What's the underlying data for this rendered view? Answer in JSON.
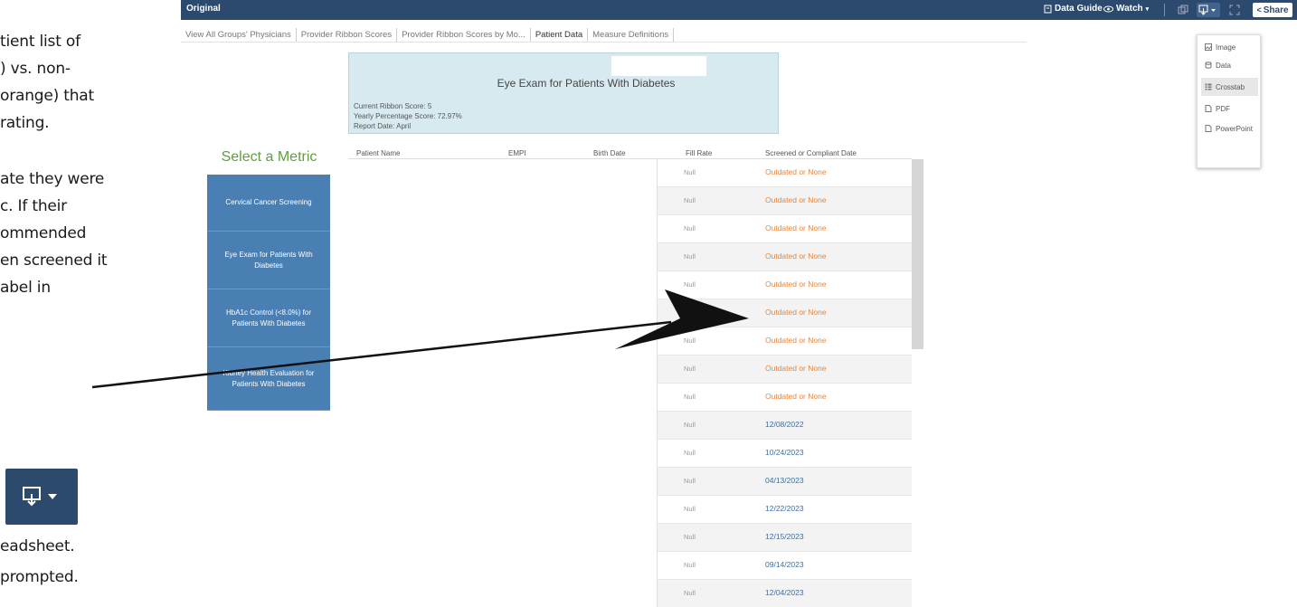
{
  "instructions": {
    "lines": [
      "tient list of",
      ") vs. non-",
      "orange) that",
      " rating.",
      "ate they were",
      "c. If their",
      "ommended",
      "en screened it",
      "abel in",
      "eadsheet.",
      " prompted."
    ]
  },
  "topbar": {
    "title": "Original",
    "data_guide": "Data Guide",
    "watch": "Watch",
    "share": "Share"
  },
  "tabs": [
    "View All Groups' Physicians",
    "Provider Ribbon Scores",
    "Provider Ribbon Scores by Mo...",
    "Patient Data",
    "Measure Definitions"
  ],
  "header": {
    "title": "Eye Exam for Patients With Diabetes",
    "ribbon_score": "Current Ribbon Score: 5",
    "yearly_score": "Yearly Percentage Score: 72.97%",
    "report_date": "Report Date: April"
  },
  "metrics": {
    "title": "Select a Metric",
    "items": [
      "Cervical Cancer Screening",
      "Eye Exam for Patients With Diabetes",
      "HbA1c Control (<8.0%) for Patients With Diabetes",
      "Kidney Health Evaluation for Patients With Diabetes"
    ]
  },
  "table": {
    "headers": [
      "Patient Name",
      "EMPI",
      "Birth Date",
      "Fill Rate",
      "Screened or Compliant Date"
    ],
    "rows": [
      {
        "fill": "Null",
        "date": "Outdated or None"
      },
      {
        "fill": "Null",
        "date": "Outdated or None"
      },
      {
        "fill": "Null",
        "date": "Outdated or None"
      },
      {
        "fill": "Null",
        "date": "Outdated or None"
      },
      {
        "fill": "Null",
        "date": "Outdated or None"
      },
      {
        "fill": "Null",
        "date": "Outdated or None"
      },
      {
        "fill": "Null",
        "date": "Outdated or None"
      },
      {
        "fill": "Null",
        "date": "Outdated or None"
      },
      {
        "fill": "Null",
        "date": "Outdated or None"
      },
      {
        "fill": "Null",
        "date": "12/08/2022"
      },
      {
        "fill": "Null",
        "date": "10/24/2023"
      },
      {
        "fill": "Null",
        "date": "04/13/2023"
      },
      {
        "fill": "Null",
        "date": "12/22/2023"
      },
      {
        "fill": "Null",
        "date": "12/15/2023"
      },
      {
        "fill": "Null",
        "date": "09/14/2023"
      },
      {
        "fill": "Null",
        "date": "12/04/2023"
      }
    ]
  },
  "download_menu": {
    "items": [
      "Image",
      "Data",
      "Crosstab",
      "PDF",
      "PowerPoint"
    ],
    "highlighted": "Crosstab"
  },
  "colors": {
    "topbar": "#2c4a6e",
    "metric_button": "#4a7fb3",
    "outdated": "#e8853c",
    "compliant": "#3a6fa8",
    "select_title": "#5ea03c"
  }
}
